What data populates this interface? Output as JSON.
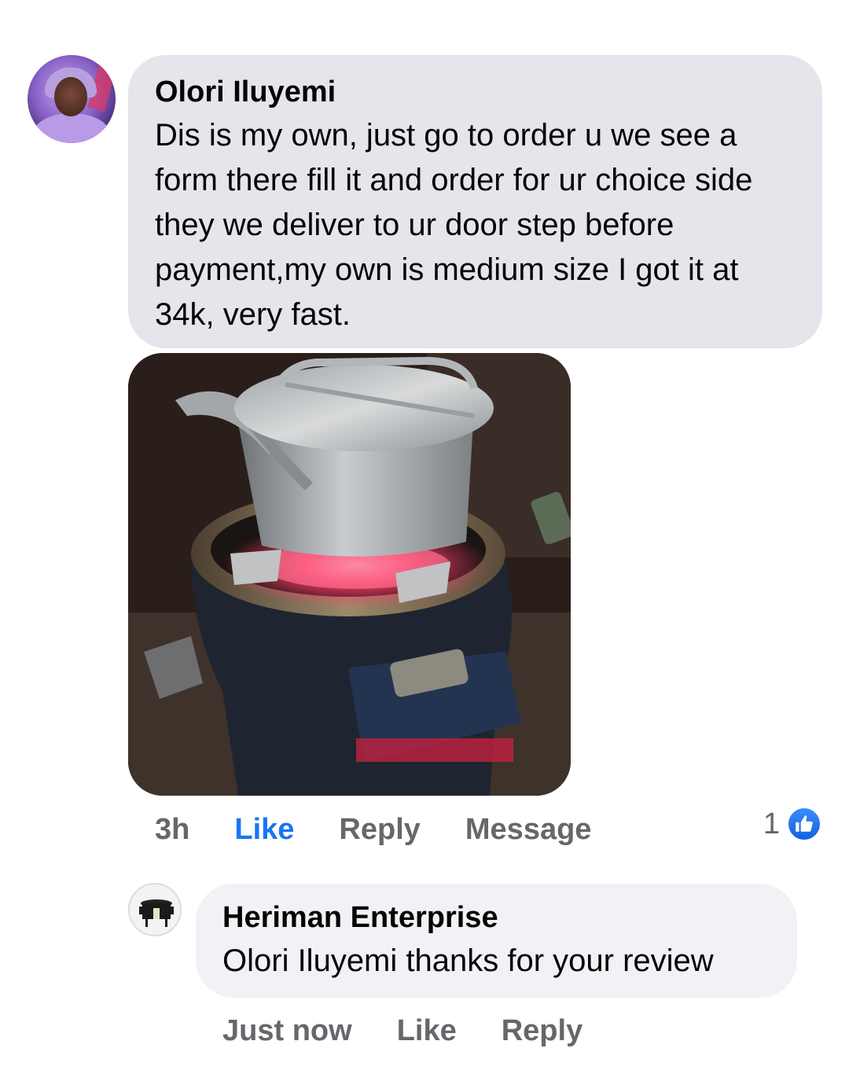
{
  "comment": {
    "author": "Olori Iluyemi",
    "text": "Dis is my own, just go to order u we see a form there fill it and order for ur choice side they we deliver to ur door step before payment,my own is medium size I got it at 34k, very fast.",
    "time": "3h",
    "like_label": "Like",
    "reply_label": "Reply",
    "message_label": "Message",
    "reaction_count": "1",
    "reaction_icon": "thumbs-up-icon",
    "like_color": "#1877f2"
  },
  "reply": {
    "author": "Heriman Enterprise",
    "text": "Olori Iluyemi thanks for your review",
    "time": "Just now",
    "like_label": "Like",
    "reply_label": "Reply"
  }
}
